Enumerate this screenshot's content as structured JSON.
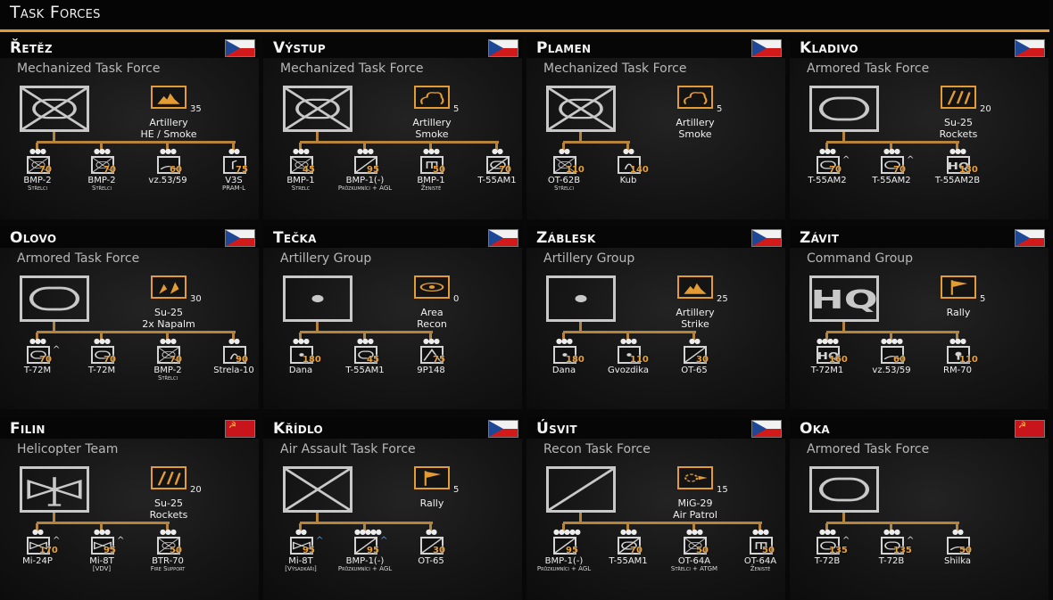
{
  "header": {
    "title": "Task Forces"
  },
  "colors": {
    "accent": "#e39b34",
    "tree": "#b6833a",
    "strength": "#e9a13a"
  },
  "cards": [
    {
      "name": "Řetěz",
      "flag": "cz",
      "subtitle": "Mechanized Task Force",
      "symbol": "mech",
      "ability": {
        "icon": "artillery-icon",
        "count": "35",
        "name": "Artillery",
        "detail": "HE / Smoke"
      },
      "units": [
        {
          "dots": "●●●",
          "icon": "mech",
          "strength": "70",
          "name": "BMP-2",
          "sub": "Střelci",
          "up": ""
        },
        {
          "dots": "●●●",
          "icon": "mech",
          "strength": "70",
          "name": "BMP-2",
          "sub": "Střelci",
          "up": ""
        },
        {
          "dots": "●●●",
          "icon": "sp-gun",
          "strength": "60",
          "name": "vz.53/59",
          "sub": "",
          "up": ""
        },
        {
          "dots": "●●",
          "icon": "launcher",
          "strength": "75",
          "name": "V3S",
          "sub": "PRAM-L",
          "up": ""
        }
      ]
    },
    {
      "name": "Výstup",
      "flag": "cz",
      "subtitle": "Mechanized Task Force",
      "symbol": "mech",
      "ability": {
        "icon": "smoke-icon",
        "count": "5",
        "name": "Artillery",
        "detail": "Smoke"
      },
      "units": [
        {
          "dots": "●●●",
          "icon": "mech",
          "strength": "45",
          "name": "BMP-1",
          "sub": "Strelc",
          "up": ""
        },
        {
          "dots": "●●●",
          "icon": "recon",
          "strength": "95",
          "name": "BMP-1(-)",
          "sub": "Průzkumníci + AGL",
          "up": ""
        },
        {
          "dots": "●●●",
          "icon": "engineer",
          "strength": "50",
          "name": "BMP-1",
          "sub": "Ženisté",
          "up": ""
        },
        {
          "dots": "●●",
          "icon": "recon-armor",
          "strength": "70",
          "name": "T-55AM1",
          "sub": "",
          "up": ""
        }
      ]
    },
    {
      "name": "Plamen",
      "flag": "cz",
      "subtitle": "Mechanized Task Force",
      "symbol": "mech",
      "ability": {
        "icon": "smoke-icon",
        "count": "5",
        "name": "Artillery",
        "detail": "Smoke"
      },
      "units": [
        {
          "dots": "●●",
          "icon": "mech",
          "strength": "110",
          "name": "OT-62B",
          "sub": "Střelci",
          "up": ""
        },
        {
          "dots": "●●",
          "icon": "sam",
          "strength": "140",
          "name": "Kub",
          "sub": "",
          "up": ""
        }
      ]
    },
    {
      "name": "Kladivo",
      "flag": "cz",
      "subtitle": "Armored Task Force",
      "symbol": "armor",
      "ability": {
        "icon": "rockets-icon",
        "count": "20",
        "name": "Su-25",
        "detail": "Rockets"
      },
      "units": [
        {
          "dots": "●●●",
          "icon": "armor",
          "strength": "70",
          "name": "T-55AM2",
          "sub": "",
          "up": "^"
        },
        {
          "dots": "●●●",
          "icon": "armor",
          "strength": "70",
          "name": "T-55AM2",
          "sub": "",
          "up": "^"
        },
        {
          "dots": "●●●",
          "icon": "hq",
          "strength": "130",
          "name": "T-55AM2B",
          "sub": "",
          "up": ""
        }
      ]
    },
    {
      "name": "Olovo",
      "flag": "cz",
      "subtitle": "Armored Task Force",
      "symbol": "armor",
      "ability": {
        "icon": "napalm-icon",
        "count": "30",
        "name": "Su-25",
        "detail": "2x Napalm"
      },
      "units": [
        {
          "dots": "●●●",
          "icon": "armor",
          "strength": "70",
          "name": "T-72M",
          "sub": "",
          "up": "^"
        },
        {
          "dots": "●●●",
          "icon": "armor",
          "strength": "70",
          "name": "T-72M",
          "sub": "",
          "up": ""
        },
        {
          "dots": "●●●",
          "icon": "mech",
          "strength": "70",
          "name": "BMP-2",
          "sub": "Střelci",
          "up": ""
        },
        {
          "dots": "●●",
          "icon": "sam",
          "strength": "90",
          "name": "Strela-10",
          "sub": "",
          "up": ""
        }
      ]
    },
    {
      "name": "Tečka",
      "flag": "cz",
      "subtitle": "Artillery Group",
      "symbol": "artillery",
      "ability": {
        "icon": "eye-icon",
        "count": "0",
        "name": "Area",
        "detail": "Recon"
      },
      "units": [
        {
          "dots": "●●●",
          "icon": "artillery",
          "strength": "180",
          "name": "Dana",
          "sub": "",
          "up": ""
        },
        {
          "dots": "●●●",
          "icon": "armor",
          "strength": "45",
          "name": "T-55AM1",
          "sub": "",
          "up": ""
        },
        {
          "dots": "●●●",
          "icon": "at",
          "strength": "75",
          "name": "9P148",
          "sub": "",
          "up": ""
        }
      ]
    },
    {
      "name": "Záblesk",
      "flag": "cz",
      "subtitle": "Artillery Group",
      "symbol": "artillery",
      "ability": {
        "icon": "artillery-icon",
        "count": "25",
        "name": "Artillery",
        "detail": "Strike"
      },
      "units": [
        {
          "dots": "●●●",
          "icon": "artillery",
          "strength": "180",
          "name": "Dana",
          "sub": "",
          "up": ""
        },
        {
          "dots": "●●●",
          "icon": "artillery",
          "strength": "110",
          "name": "Gvozdika",
          "sub": "",
          "up": ""
        },
        {
          "dots": "●●",
          "icon": "recon",
          "strength": "30",
          "name": "OT-65",
          "sub": "",
          "up": ""
        }
      ]
    },
    {
      "name": "Závit",
      "flag": "cz",
      "subtitle": "Command Group",
      "symbol": "hq",
      "ability": {
        "icon": "flag-icon",
        "count": "5",
        "name": "Rally",
        "detail": ""
      },
      "units": [
        {
          "dots": "●●●●",
          "icon": "hq",
          "strength": "160",
          "name": "T-72M1",
          "sub": "",
          "up": ""
        },
        {
          "dots": "●●●●",
          "icon": "sp-gun",
          "strength": "60",
          "name": "vz.53/59",
          "sub": "",
          "up": ""
        },
        {
          "dots": "●●●",
          "icon": "radar",
          "strength": "110",
          "name": "RM-70",
          "sub": "",
          "up": ""
        }
      ]
    },
    {
      "name": "Filin",
      "flag": "su",
      "subtitle": "Helicopter Team",
      "symbol": "heli",
      "ability": {
        "icon": "rockets-icon",
        "count": "20",
        "name": "Su-25",
        "detail": "Rockets"
      },
      "units": [
        {
          "dots": "●●",
          "icon": "heli",
          "strength": "170",
          "name": "Mi-24P",
          "sub": "",
          "up": "^"
        },
        {
          "dots": "●●●",
          "icon": "heli",
          "strength": "95",
          "name": "Mi-8T",
          "sub": "[VDV]",
          "up": "^"
        },
        {
          "dots": "●●●",
          "icon": "mech",
          "strength": "50",
          "name": "BTR-70",
          "sub": "Fire Support",
          "up": ""
        }
      ]
    },
    {
      "name": "Křídlo",
      "flag": "cz",
      "subtitle": "Air Assault Task Force",
      "symbol": "infantry",
      "ability": {
        "icon": "flag-icon",
        "count": "5",
        "name": "Rally",
        "detail": ""
      },
      "units": [
        {
          "dots": "●●",
          "icon": "heli",
          "strength": "95",
          "name": "Mi-8T",
          "sub": "[Výsadkáři]",
          "up": "^"
        },
        {
          "dots": "●●●●●",
          "icon": "recon",
          "strength": "95",
          "name": "BMP-1(-)",
          "sub": "Průzkumníci + AGL",
          "up": "^"
        },
        {
          "dots": "●●",
          "icon": "recon",
          "strength": "30",
          "name": "OT-65",
          "sub": "",
          "up": ""
        }
      ]
    },
    {
      "name": "Úsvit",
      "flag": "cz",
      "subtitle": "Recon Task Force",
      "symbol": "recon",
      "ability": {
        "icon": "air-patrol-icon",
        "count": "15",
        "name": "MiG-29",
        "detail": "Air Patrol"
      },
      "units": [
        {
          "dots": "●●●●●",
          "icon": "recon",
          "strength": "95",
          "name": "BMP-1(-)",
          "sub": "Průzkumníci + AGL",
          "up": ""
        },
        {
          "dots": "●●●",
          "icon": "recon-armor",
          "strength": "70",
          "name": "T-55AM1",
          "sub": "",
          "up": ""
        },
        {
          "dots": "●●●",
          "icon": "mech",
          "strength": "50",
          "name": "OT-64A",
          "sub": "Střelci + ATGM",
          "up": ""
        },
        {
          "dots": "●●●",
          "icon": "engineer",
          "strength": "50",
          "name": "OT-64A",
          "sub": "Ženisté",
          "up": ""
        }
      ]
    },
    {
      "name": "Oka",
      "flag": "su",
      "subtitle": "Armored Task Force",
      "symbol": "armor",
      "ability": {
        "icon": "flag-icon",
        "count": "",
        "name": "",
        "detail": ""
      },
      "units": [
        {
          "dots": "●●●",
          "icon": "armor",
          "strength": "135",
          "name": "T-72B",
          "sub": "",
          "up": "^"
        },
        {
          "dots": "●●●",
          "icon": "armor",
          "strength": "135",
          "name": "T-72B",
          "sub": "",
          "up": "^"
        },
        {
          "dots": "●●",
          "icon": "sp-gun",
          "strength": "50",
          "name": "Shilka",
          "sub": "",
          "up": ""
        }
      ]
    }
  ]
}
